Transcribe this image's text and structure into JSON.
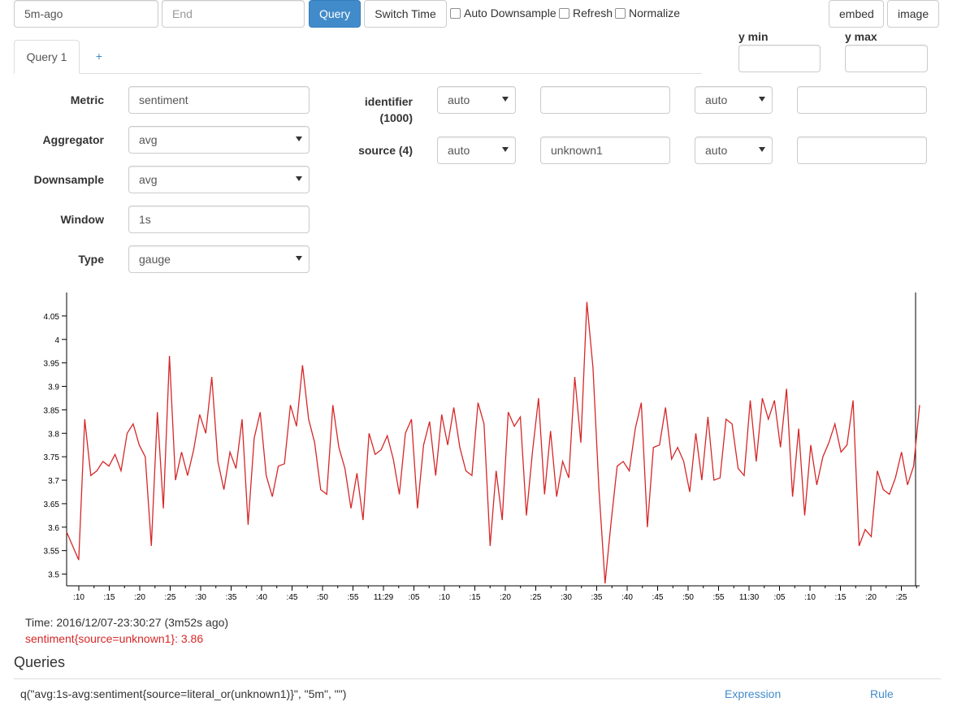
{
  "toolbar": {
    "start_value": "5m-ago",
    "end_placeholder": "End",
    "query_label": "Query",
    "switch_time_label": "Switch Time",
    "auto_downsample_label": "Auto Downsample",
    "refresh_label": "Refresh",
    "normalize_label": "Normalize",
    "embed_label": "embed",
    "image_label": "image"
  },
  "yrange": {
    "min_label": "y min",
    "max_label": "y max",
    "min_value": "",
    "max_value": ""
  },
  "tabs": [
    {
      "label": "Query 1"
    },
    {
      "label": "+"
    }
  ],
  "form": {
    "metric_label": "Metric",
    "metric_value": "sentiment",
    "aggregator_label": "Aggregator",
    "aggregator_value": "avg",
    "downsample_label": "Downsample",
    "downsample_value": "avg",
    "window_label": "Window",
    "window_value": "1s",
    "type_label": "Type",
    "type_value": "gauge"
  },
  "tags": [
    {
      "label_line1": "identifier",
      "label_line2": "(1000)",
      "mode1": "auto",
      "value": "",
      "mode2": "auto",
      "extra": ""
    },
    {
      "label_line1": "source (4)",
      "label_line2": "",
      "mode1": "auto",
      "value": "unknown1",
      "mode2": "auto",
      "extra": ""
    }
  ],
  "legend": {
    "time_text": "Time: 2016/12/07-23:30:27 (3m52s ago)",
    "series_text": "sentiment{source=unknown1}: 3.86"
  },
  "queries": {
    "heading": "Queries",
    "query_text": "q(\"avg:1s-avg:sentiment{source=literal_or(unknown1)}\", \"5m\", \"\")",
    "expression_label": "Expression",
    "rule_label": "Rule"
  },
  "chart_data": {
    "type": "line",
    "line_color": "#d62728",
    "ylim": [
      3.475,
      4.1
    ],
    "yticks": [
      3.5,
      3.55,
      3.6,
      3.65,
      3.7,
      3.75,
      3.8,
      3.85,
      3.9,
      3.95,
      4,
      4.05
    ],
    "ytick_labels": [
      "3.5",
      "3.55",
      "3.6",
      "3.65",
      "3.7",
      "3.75",
      "3.8",
      "3.85",
      "3.9",
      "3.95",
      "4",
      "4.05"
    ],
    "xtick_labels": [
      ":10",
      ":15",
      ":20",
      ":25",
      ":30",
      ":35",
      ":40",
      ":45",
      ":50",
      ":55",
      "11:29",
      ":05",
      ":10",
      ":15",
      ":20",
      ":25",
      ":30",
      ":35",
      ":40",
      ":45",
      ":50",
      ":55",
      "11:30",
      ":05",
      ":10",
      ":15",
      ":20",
      ":25"
    ],
    "series": [
      {
        "values": [
          3.59,
          3.56,
          3.53,
          3.83,
          3.71,
          3.72,
          3.74,
          3.73,
          3.755,
          3.72,
          3.8,
          3.82,
          3.775,
          3.75,
          3.56,
          3.845,
          3.64,
          3.965,
          3.7,
          3.76,
          3.71,
          3.765,
          3.84,
          3.8,
          3.92,
          3.74,
          3.68,
          3.76,
          3.725,
          3.83,
          3.605,
          3.79,
          3.845,
          3.71,
          3.665,
          3.73,
          3.735,
          3.86,
          3.815,
          3.945,
          3.83,
          3.78,
          3.68,
          3.67,
          3.86,
          3.77,
          3.725,
          3.64,
          3.715,
          3.615,
          3.8,
          3.755,
          3.765,
          3.795,
          3.745,
          3.67,
          3.8,
          3.83,
          3.64,
          3.775,
          3.825,
          3.71,
          3.84,
          3.775,
          3.855,
          3.77,
          3.72,
          3.71,
          3.865,
          3.82,
          3.56,
          3.72,
          3.615,
          3.845,
          3.815,
          3.835,
          3.625,
          3.76,
          3.875,
          3.67,
          3.805,
          3.665,
          3.74,
          3.705,
          3.92,
          3.78,
          4.08,
          3.94,
          3.68,
          3.48,
          3.61,
          3.73,
          3.74,
          3.72,
          3.81,
          3.865,
          3.6,
          3.77,
          3.775,
          3.855,
          3.745,
          3.77,
          3.74,
          3.675,
          3.8,
          3.7,
          3.835,
          3.7,
          3.705,
          3.83,
          3.82,
          3.725,
          3.71,
          3.87,
          3.74,
          3.875,
          3.83,
          3.87,
          3.77,
          3.895,
          3.665,
          3.81,
          3.625,
          3.775,
          3.69,
          3.75,
          3.78,
          3.82,
          3.76,
          3.775,
          3.87,
          3.56,
          3.595,
          3.58,
          3.72,
          3.68,
          3.67,
          3.705,
          3.76,
          3.69,
          3.73,
          3.86
        ]
      }
    ]
  }
}
